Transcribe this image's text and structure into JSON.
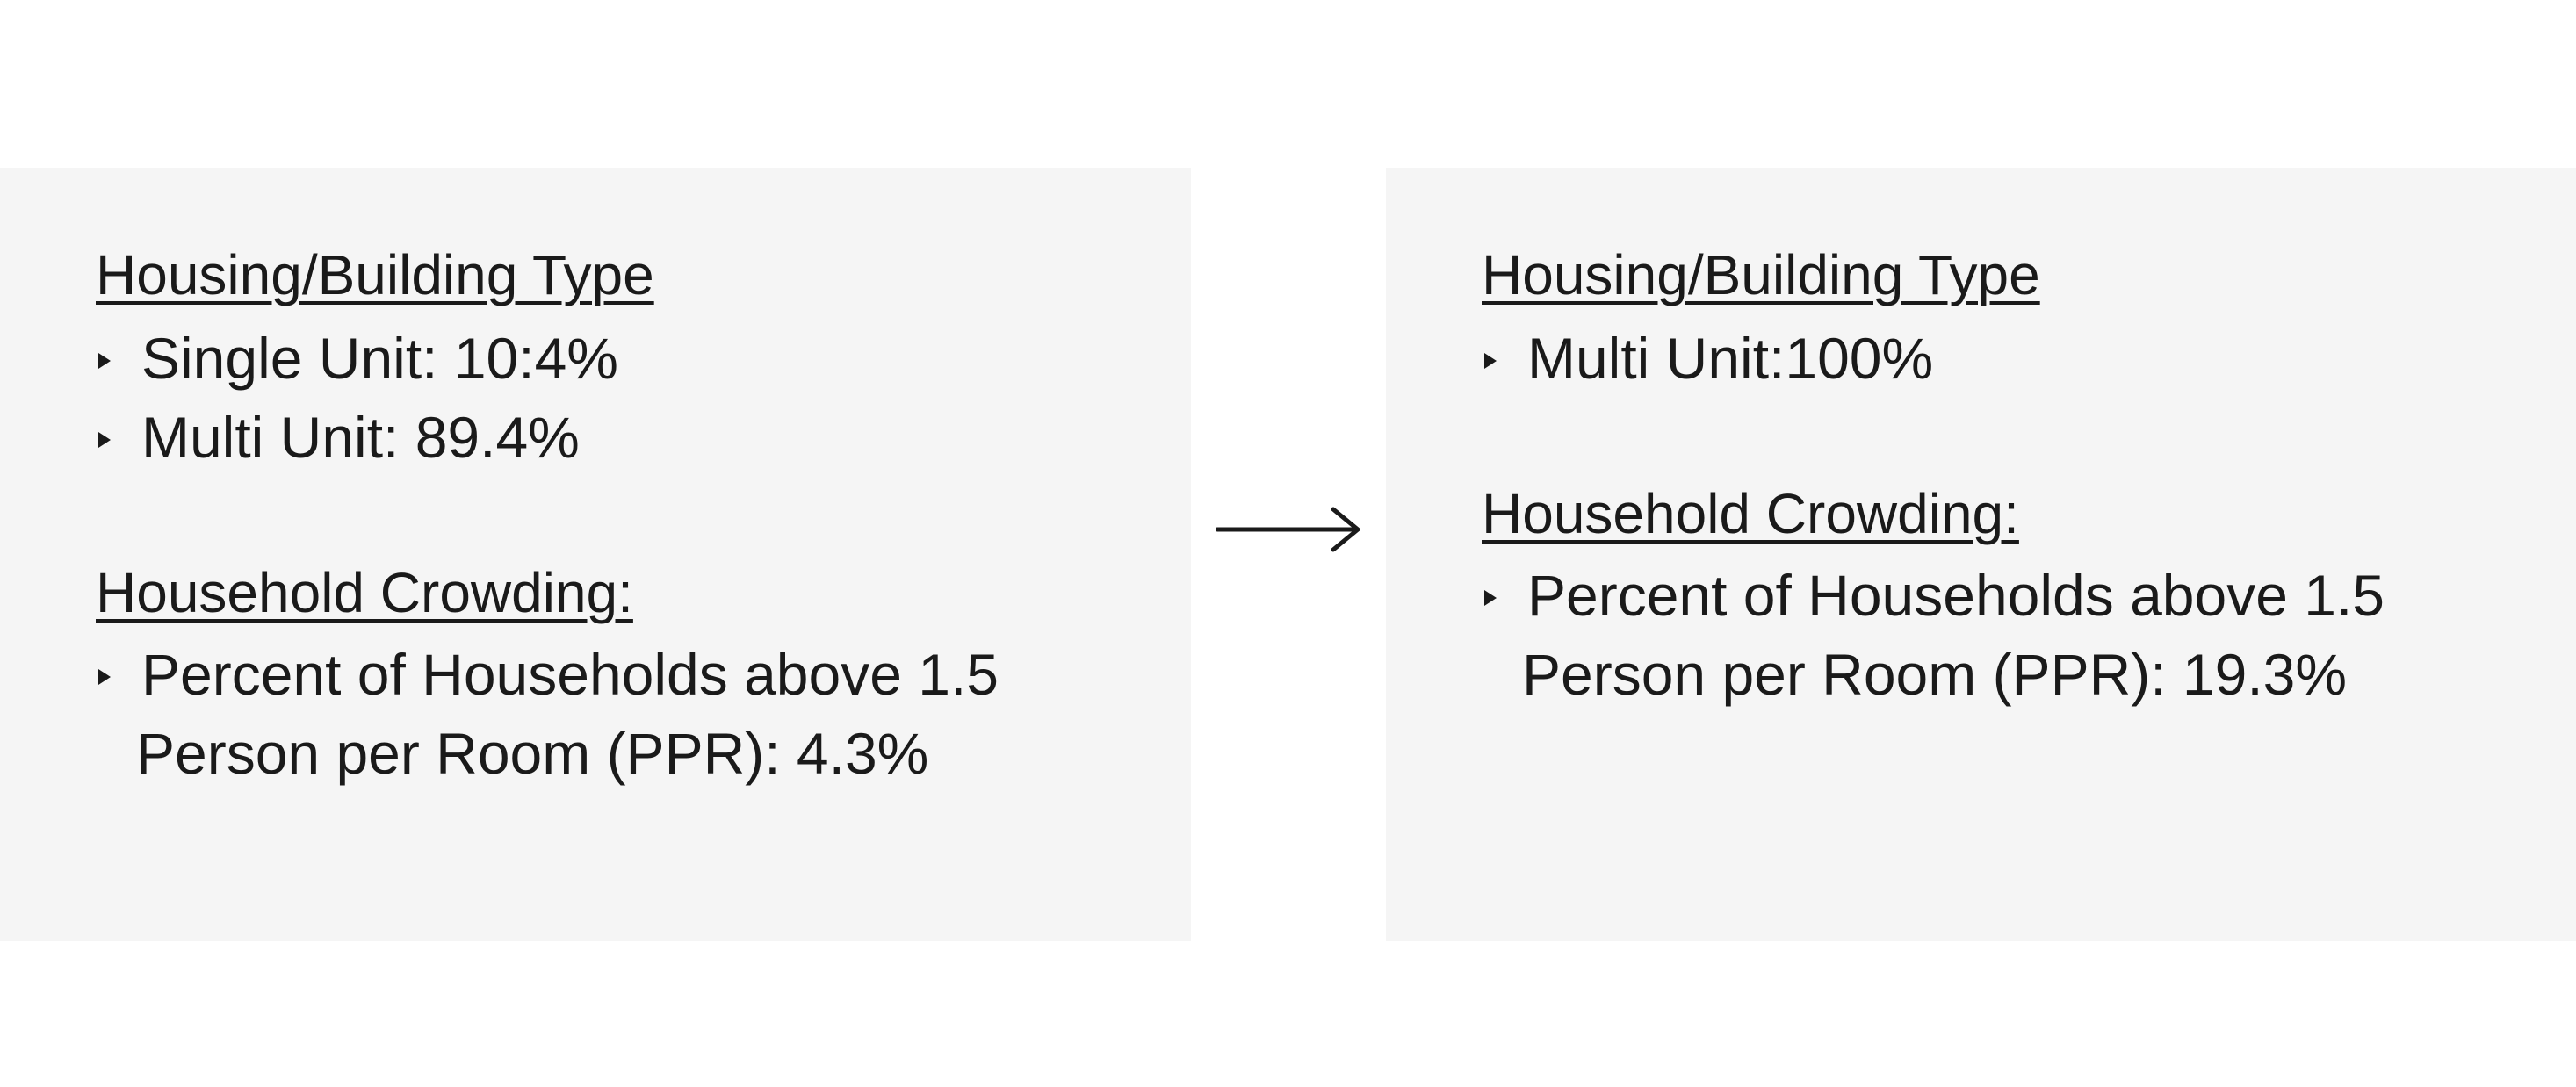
{
  "left": {
    "housing_heading": "Housing/Building Type",
    "housing_items": [
      "Single Unit: 10:4%",
      "Multi Unit: 89.4%"
    ],
    "crowding_heading": "Household Crowding:",
    "crowding_line1": "Percent of Households above 1.5",
    "crowding_line2": "Person per Room (PPR): 4.3%"
  },
  "right": {
    "housing_heading": "Housing/Building Type",
    "housing_items": [
      "Multi Unit:100%"
    ],
    "crowding_heading": "Household Crowding:",
    "crowding_line1": "Percent of Households above 1.5",
    "crowding_line2": "Person per Room (PPR): 19.3%"
  },
  "icons": {
    "transition": "right-arrow-icon"
  },
  "colors": {
    "panel_bg": "#f5f5f5",
    "text": "#1a1a1a",
    "page_bg": "#ffffff"
  }
}
